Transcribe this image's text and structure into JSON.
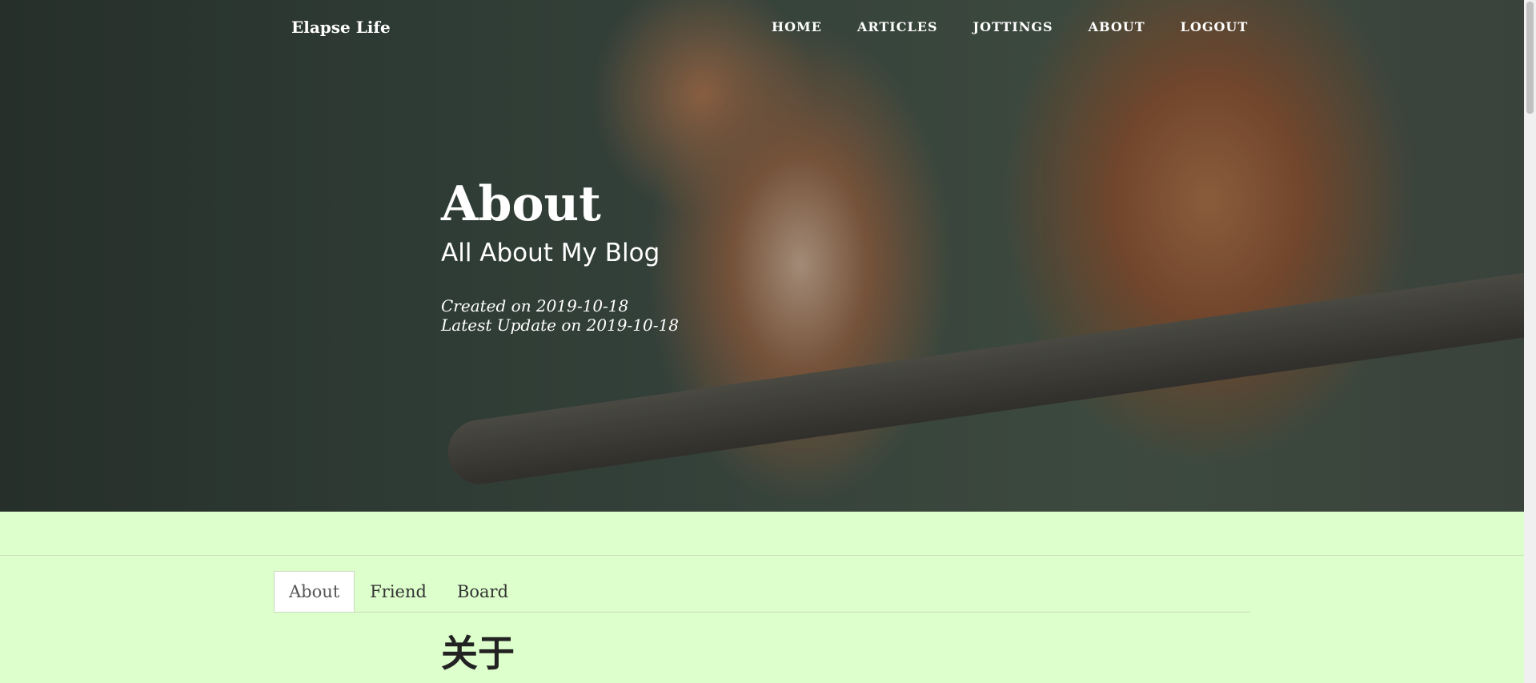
{
  "site": {
    "brand": "Elapse Life"
  },
  "nav": {
    "items": [
      {
        "label": "HOME"
      },
      {
        "label": "ARTICLES"
      },
      {
        "label": "JOTTINGS"
      },
      {
        "label": "ABOUT"
      },
      {
        "label": "LOGOUT"
      }
    ]
  },
  "hero": {
    "title": "About",
    "subtitle": "All About My Blog",
    "created": "Created on 2019-10-18",
    "updated": "Latest Update on 2019-10-18",
    "image": "squirrel-photo"
  },
  "tabs": [
    {
      "label": "About",
      "active": true
    },
    {
      "label": "Friend",
      "active": false
    },
    {
      "label": "Board",
      "active": false
    }
  ],
  "content": {
    "heading": "关于"
  },
  "colors": {
    "page_bg": "#ddffcc",
    "tab_active_bg": "#ffffff"
  }
}
